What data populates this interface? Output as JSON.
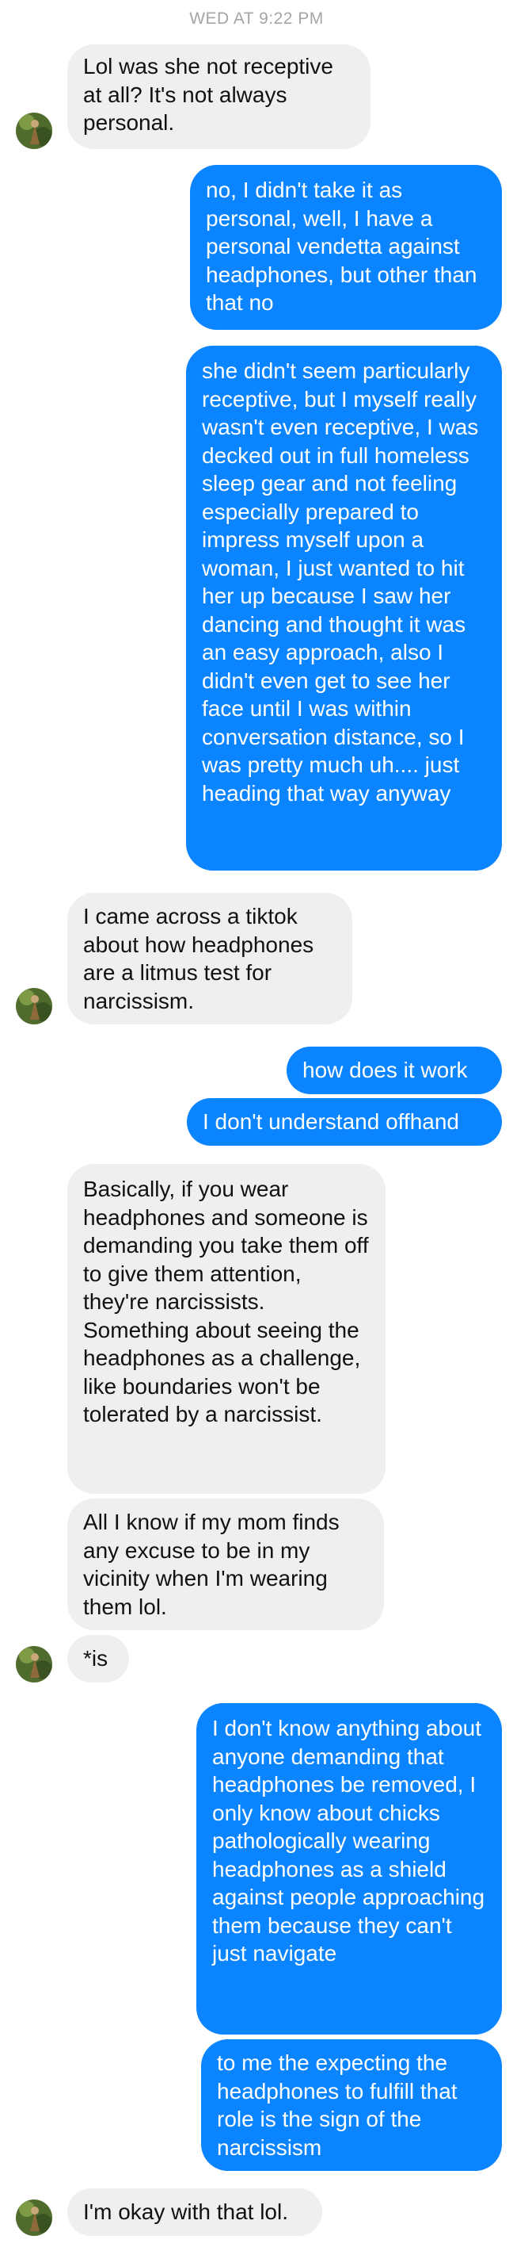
{
  "timestamp": "WED AT 9:22 PM",
  "colors": {
    "sent_bubble": "#0a84ff",
    "received_bubble": "#efefef",
    "timestamp": "#a5a5a5"
  },
  "messages": [
    {
      "from": "them",
      "text": "Lol was she not receptive at all? It's not always personal."
    },
    {
      "from": "me",
      "text": "no, I didn't take it as personal, well, I have a personal vendetta against headphones, but other than that no"
    },
    {
      "from": "me",
      "text": "she didn't seem particularly receptive, but I myself really wasn't even receptive, I was decked out in full homeless sleep gear and not feeling especially prepared to impress myself upon a woman, I just wanted to hit her up because I saw her dancing and thought it was an easy approach, also I didn't even get to see her face until I was within conversation distance, so I was pretty much uh.... just heading that way anyway"
    },
    {
      "from": "them",
      "text": "I came across a tiktok about how headphones are a litmus test for narcissism."
    },
    {
      "from": "me",
      "text": "how does it work"
    },
    {
      "from": "me",
      "text": "I don't understand offhand"
    },
    {
      "from": "them",
      "text": "Basically, if you wear headphones and someone is demanding you take them off to give them attention, they're narcissists. Something about seeing the headphones as a challenge, like boundaries won't be tolerated by a narcissist."
    },
    {
      "from": "them",
      "text": "All I know if my mom finds any excuse to be in my vicinity when I'm wearing them lol."
    },
    {
      "from": "them",
      "text": "*is"
    },
    {
      "from": "me",
      "text": "I don't know anything about anyone demanding that headphones be removed, I only know about chicks pathologically wearing headphones as a shield against people approaching them because they can't just navigate"
    },
    {
      "from": "me",
      "text": "to me the expecting the headphones to fulfill that role is the sign of the narcissism"
    },
    {
      "from": "them",
      "text": "I'm okay with that lol."
    }
  ]
}
